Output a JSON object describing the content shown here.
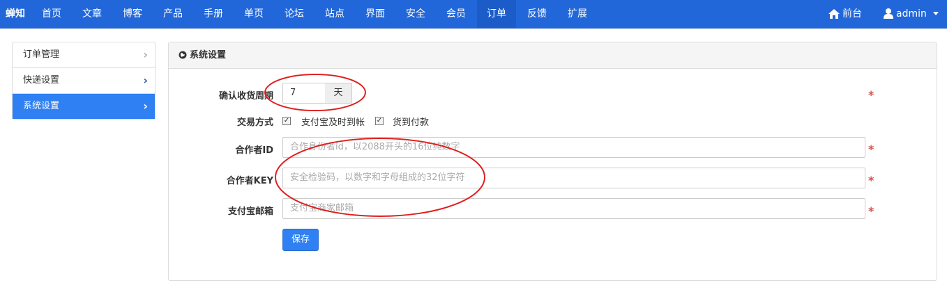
{
  "navbar": {
    "brand": "蝉知",
    "items": [
      "首页",
      "文章",
      "博客",
      "产品",
      "手册",
      "单页",
      "论坛",
      "站点",
      "界面",
      "安全",
      "会员",
      "订单",
      "反馈",
      "扩展"
    ],
    "active_item": "订单",
    "frontend_label": "前台",
    "user_label": "admin"
  },
  "sidebar": {
    "items": [
      "订单管理",
      "快递设置",
      "系统设置"
    ],
    "active_item": "系统设置"
  },
  "panel": {
    "title": "系统设置",
    "confirm_period": {
      "label": "确认收货周期",
      "value": "7",
      "unit": "天"
    },
    "trade_mode": {
      "label": "交易方式",
      "option1": "支付宝及时到帐",
      "option2": "货到付款",
      "option1_checked": true,
      "option2_checked": true
    },
    "partner_id": {
      "label": "合作者ID",
      "placeholder": "合作身份者id，以2088开头的16位纯数字"
    },
    "partner_key": {
      "label": "合作者KEY",
      "placeholder": "安全检验码，以数字和字母组成的32位字符"
    },
    "alipay_email": {
      "label": "支付宝邮箱",
      "placeholder": "支付宝商家邮箱"
    },
    "required_mark": "*",
    "save_button": "保存"
  },
  "colors": {
    "nav_bg": "#2267d9",
    "accent": "#2f80f2",
    "required": "#d9534f",
    "annotation": "#e02020"
  }
}
